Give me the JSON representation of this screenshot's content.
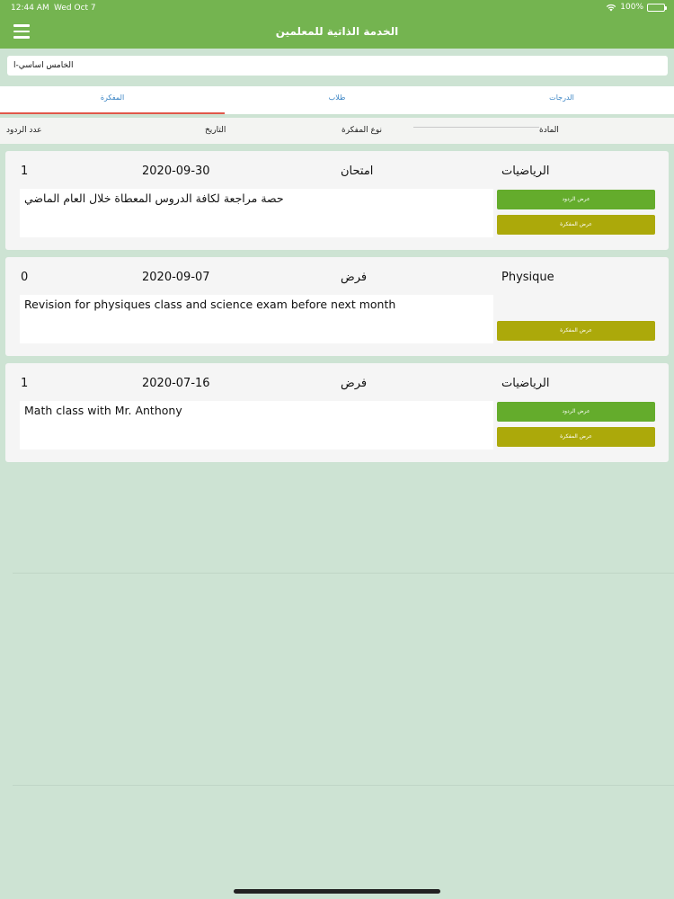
{
  "status_bar": {
    "time": "12:44 AM",
    "date": "Wed Oct 7",
    "battery": "100%"
  },
  "nav": {
    "title": "الخدمة الذاتية للمعلمين"
  },
  "class_selector": {
    "value": "الخامس اساسي-ا"
  },
  "tabs": [
    {
      "label": "المفكرة",
      "active": true
    },
    {
      "label": "طلاب",
      "active": false
    },
    {
      "label": "الدرجات",
      "active": false
    }
  ],
  "headers": {
    "replies_count": "عدد الردود",
    "date": "التاريخ",
    "memo_type": "نوع المفكرة",
    "subject": "المادة"
  },
  "memos": [
    {
      "replies": "1",
      "date": "2020-09-30",
      "type": "امتحان",
      "subject": "الرياضيات",
      "description": "حصة مراجعة لكافة الدروس المعطاة خلال العام الماضي",
      "view_replies_label": "عرض الردود",
      "view_memo_label": "عرض المفكرة"
    },
    {
      "replies": "0",
      "date": "2020-09-07",
      "type": "فرض",
      "subject": "Physique",
      "description": "Revision for physiques class and science exam before next month",
      "view_memo_label": "عرض المفكرة"
    },
    {
      "replies": "1",
      "date": "2020-07-16",
      "type": "فرض",
      "subject": "الرياضيات",
      "description": "Math class with Mr. Anthony",
      "view_replies_label": "عرض الردود",
      "view_memo_label": "عرض المفكرة"
    }
  ],
  "colors": {
    "primary_green": "#74b450",
    "button_green": "#64ac2c",
    "button_olive": "#aca90a",
    "background": "#cde3d3",
    "tab_text": "#3a84c4",
    "tab_underline": "#e0584a"
  },
  "icons": [
    "menu-icon",
    "wifi-icon",
    "battery-icon"
  ]
}
